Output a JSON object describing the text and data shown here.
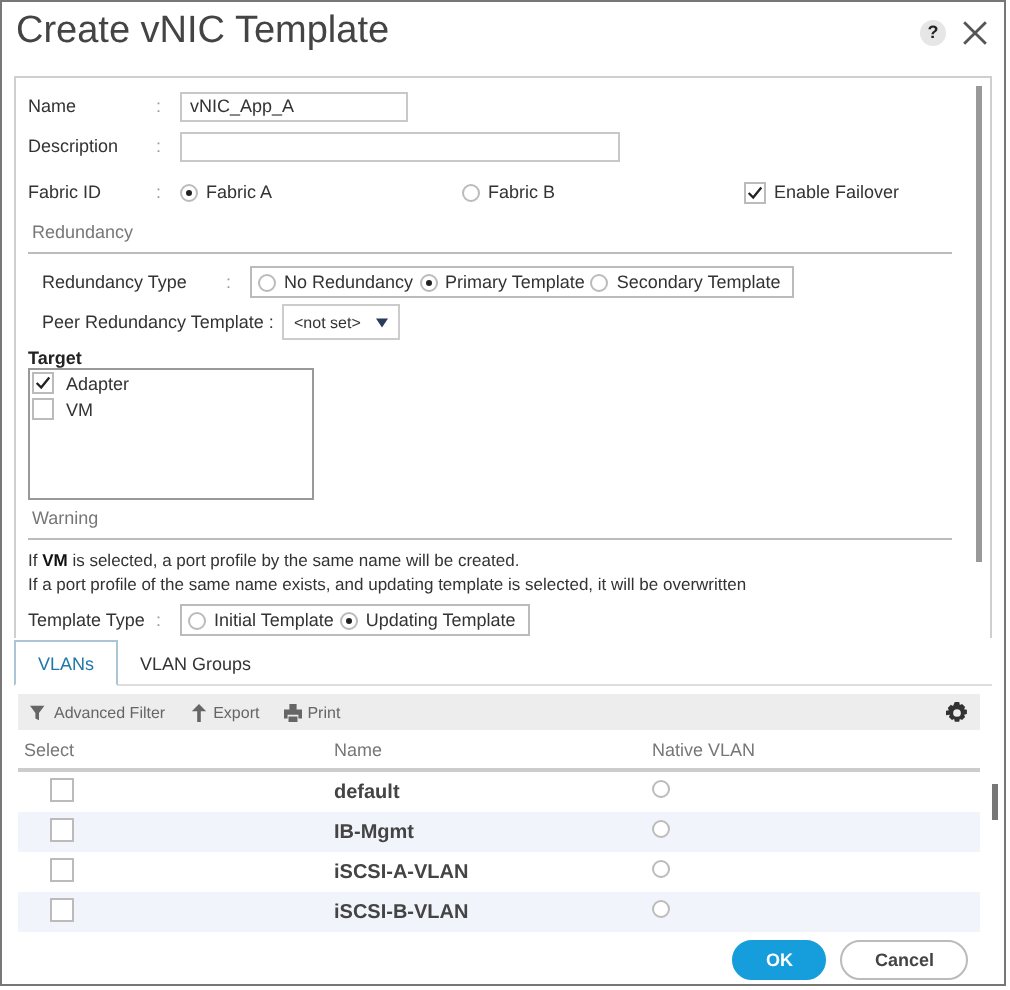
{
  "window": {
    "title": "Create vNIC Template",
    "help": "?"
  },
  "fields": [
    {
      "kind": "text",
      "label": "Name",
      "separator": ":",
      "value": "vNIC_App_A"
    },
    {
      "kind": "text",
      "label": "Description",
      "separator": ":"
    },
    {
      "kind": "fabric",
      "label": "Fabric ID",
      "separator": ":",
      "options": [
        {
          "label": "Fabric A",
          "selected": true
        },
        {
          "label": "Fabric B",
          "selected": false
        }
      ],
      "failover": {
        "label": "Enable Failover",
        "checked": true
      }
    }
  ],
  "redundancy": {
    "heading": "Redundancy",
    "type": {
      "label": "Redundancy Type",
      "separator": ":",
      "options": [
        {
          "label": "No Redundancy",
          "selected": false
        },
        {
          "label": "Primary Template",
          "selected": true
        },
        {
          "label": "Secondary Template",
          "selected": false
        }
      ]
    },
    "peer": {
      "label": "Peer Redundancy Template :",
      "value": "<not set>"
    }
  },
  "target": {
    "heading": "Target",
    "items": [
      {
        "label": "Adapter",
        "checked": true
      },
      {
        "label": "VM",
        "checked": false
      }
    ]
  },
  "warning": {
    "heading": "Warning",
    "lines": [
      "If **VM** is selected, a port profile by the same name will be created.",
      "If a port profile of the same name exists, and updating template is selected, it will be overwritten"
    ]
  },
  "template_type": {
    "label": "Template Type",
    "separator": ":",
    "options": [
      {
        "label": "Initial Template",
        "selected": false
      },
      {
        "label": "Updating Template",
        "selected": true
      }
    ]
  },
  "tabs": [
    {
      "label": "VLANs",
      "selected": true
    },
    {
      "label": "VLAN Groups",
      "selected": false
    }
  ],
  "toolbar": [
    {
      "kind": "filter",
      "label": "Advanced Filter"
    },
    {
      "kind": "export",
      "label": "Export"
    },
    {
      "kind": "print",
      "label": "Print"
    }
  ],
  "table": {
    "columns": [
      "Select",
      "Name",
      "Native VLAN"
    ],
    "rows": [
      {
        "checked": false,
        "name": "default",
        "native": false
      },
      {
        "checked": false,
        "name": "IB-Mgmt",
        "native": false
      },
      {
        "checked": false,
        "name": "iSCSI-A-VLAN",
        "native": false
      },
      {
        "checked": false,
        "name": "iSCSI-B-VLAN",
        "native": false
      }
    ]
  },
  "buttons": [
    {
      "kind": "primary",
      "label": "OK"
    },
    {
      "kind": "secondary",
      "label": "Cancel"
    }
  ]
}
